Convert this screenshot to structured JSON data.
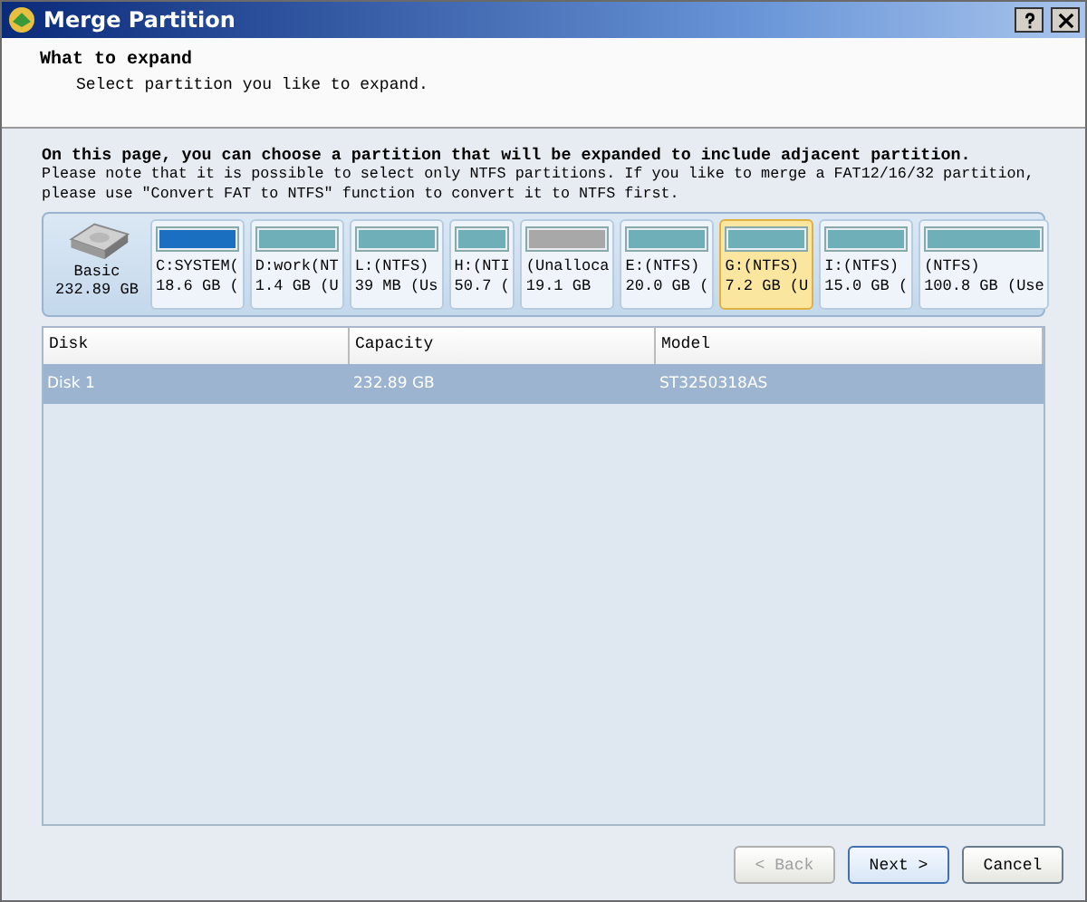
{
  "window": {
    "title": "Merge Partition"
  },
  "header": {
    "title": "What to expand",
    "subtitle": "Select partition you like to expand."
  },
  "intro": {
    "heading": "On this page, you can choose a partition that will be expanded to include adjacent partition.",
    "note": "Please note that it is possible to select only NTFS partitions. If you like to merge a FAT12/16/32 partition, please use \"Convert FAT to NTFS\" function to convert it to NTFS first."
  },
  "disk": {
    "label": "Basic",
    "size": "232.89 GB"
  },
  "partitions": [
    {
      "kind": "system",
      "name": "C:SYSTEM(",
      "size": "18.6 GB (",
      "selected": false
    },
    {
      "kind": "data",
      "name": "D:work(NT",
      "size": "1.4 GB (U",
      "selected": false
    },
    {
      "kind": "data",
      "name": "L:(NTFS)",
      "size": "39 MB (Us",
      "selected": false
    },
    {
      "kind": "data",
      "name": "H:(NTI",
      "size": "50.7 (",
      "selected": false
    },
    {
      "kind": "unallocated",
      "name": "(Unalloca",
      "size": "19.1 GB",
      "selected": false
    },
    {
      "kind": "data",
      "name": "E:(NTFS)",
      "size": "20.0 GB (",
      "selected": false
    },
    {
      "kind": "data",
      "name": "G:(NTFS)",
      "size": "7.2 GB (U",
      "selected": true
    },
    {
      "kind": "data",
      "name": "I:(NTFS)",
      "size": "15.0 GB (",
      "selected": false
    },
    {
      "kind": "data",
      "name": "(NTFS)",
      "size": "100.8 GB (Use",
      "selected": false
    }
  ],
  "table": {
    "columns": [
      "Disk",
      "Capacity",
      "Model"
    ],
    "rows": [
      {
        "cells": [
          "Disk 1",
          "232.89 GB",
          "ST3250318AS"
        ],
        "selected": true
      }
    ]
  },
  "buttons": [
    {
      "label": "< Back",
      "disabled": true
    },
    {
      "label": "Next >",
      "disabled": false
    },
    {
      "label": "Cancel",
      "disabled": false
    }
  ]
}
